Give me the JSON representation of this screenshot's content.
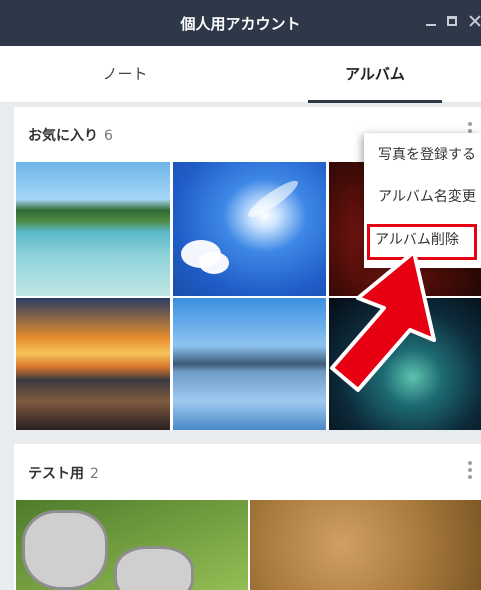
{
  "window": {
    "title": "個人用アカウント",
    "controls": [
      "minimize-icon",
      "maximize-icon",
      "close-icon"
    ]
  },
  "tabs": [
    {
      "label": "ノート",
      "selected": false
    },
    {
      "label": "アルバム",
      "selected": true
    }
  ],
  "albums": [
    {
      "name": "お気に入り",
      "count": "6",
      "photos": [
        "beach",
        "blue-sky",
        "red-texture",
        "sunset-lake",
        "mountain-lake",
        "starry-sky"
      ]
    },
    {
      "name": "テスト用",
      "count": "2",
      "photos": [
        "kittens",
        "gold-texture"
      ]
    }
  ],
  "context_menu": {
    "items": [
      "写真を登録する",
      "アルバム名変更",
      "アルバム削除"
    ],
    "highlighted_item": "アルバム削除"
  },
  "annotation": {
    "arrow_color": "#e60012",
    "highlight_color": "#e60012"
  },
  "colors": {
    "titlebar": "#2f3848",
    "tab_indicator": "#2f3848"
  }
}
